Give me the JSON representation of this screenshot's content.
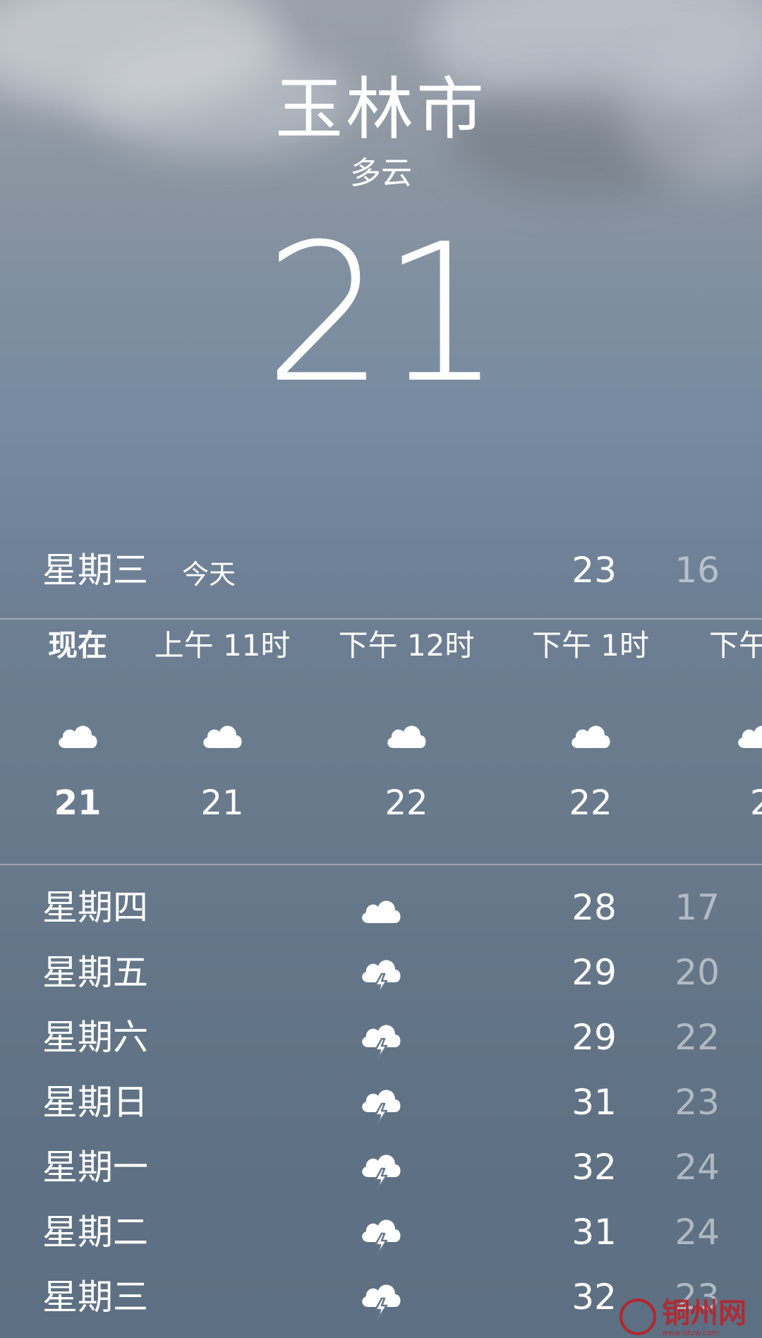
{
  "location": {
    "city": "玉林市",
    "condition": "多云",
    "current_temp": "21"
  },
  "today": {
    "day": "星期三",
    "label": "今天",
    "high": "23",
    "low": "16"
  },
  "hourly": [
    {
      "time": "现在",
      "icon": "cloud-icon",
      "temp": "21"
    },
    {
      "time": "上午 11时",
      "icon": "cloud-icon",
      "temp": "21"
    },
    {
      "time": "下午 12时",
      "icon": "cloud-icon",
      "temp": "22"
    },
    {
      "time": "下午 1时",
      "icon": "cloud-icon",
      "temp": "22"
    },
    {
      "time": "下午",
      "icon": "cloud-icon",
      "temp": "2"
    }
  ],
  "daily": [
    {
      "day": "星期四",
      "icon": "cloud-icon",
      "high": "28",
      "low": "17"
    },
    {
      "day": "星期五",
      "icon": "thunderstorm-icon",
      "high": "29",
      "low": "20"
    },
    {
      "day": "星期六",
      "icon": "thunderstorm-icon",
      "high": "29",
      "low": "22"
    },
    {
      "day": "星期日",
      "icon": "thunderstorm-icon",
      "high": "31",
      "low": "23"
    },
    {
      "day": "星期一",
      "icon": "thunderstorm-icon",
      "high": "32",
      "low": "24"
    },
    {
      "day": "星期二",
      "icon": "thunderstorm-icon",
      "high": "31",
      "low": "24"
    },
    {
      "day": "星期三",
      "icon": "thunderstorm-icon",
      "high": "32",
      "low": "23"
    }
  ],
  "watermark": {
    "text": "铜州网",
    "url": "www.btzw.com"
  },
  "colors": {
    "text": "#ffffff",
    "low_temp": "rgba(255,255,255,0.5)",
    "watermark": "#b3262e"
  }
}
